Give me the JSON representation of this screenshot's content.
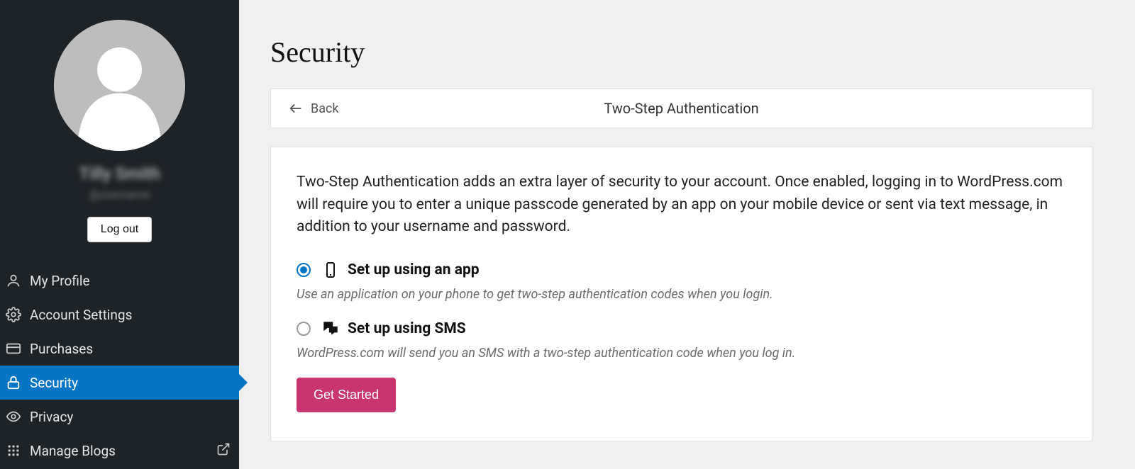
{
  "sidebar": {
    "user_name": "Tilly Smith",
    "user_handle": "@username",
    "logout_label": "Log out",
    "items": [
      {
        "label": "My Profile"
      },
      {
        "label": "Account Settings"
      },
      {
        "label": "Purchases"
      },
      {
        "label": "Security",
        "active": true
      },
      {
        "label": "Privacy"
      },
      {
        "label": "Manage Blogs",
        "external": true
      }
    ]
  },
  "page": {
    "title": "Security",
    "back_label": "Back",
    "card_title": "Two-Step Authentication",
    "intro": "Two-Step Authentication adds an extra layer of security to your account. Once enabled, logging in to WordPress.com will require you to enter a unique passcode generated by an app on your mobile device or sent via text message, in addition to your username and password.",
    "options": [
      {
        "label": "Set up using an app",
        "description": "Use an application on your phone to get two-step authentication codes when you login.",
        "selected": true
      },
      {
        "label": "Set up using SMS",
        "description": "WordPress.com will send you an SMS with a two-step authentication code when you log in.",
        "selected": false
      }
    ],
    "cta_label": "Get Started"
  }
}
